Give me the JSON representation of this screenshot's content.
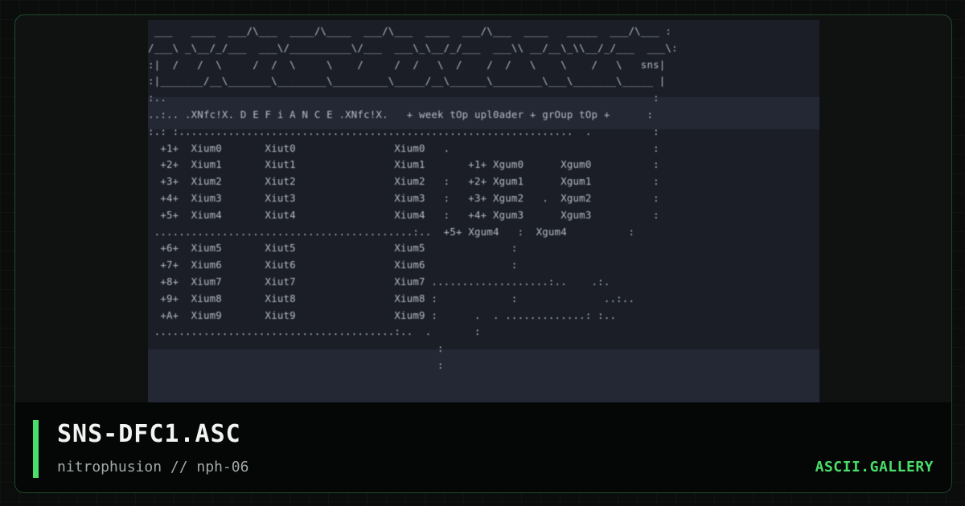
{
  "artwork": {
    "lines": [
      " ___   ____  ___/\\___  ____/\\____  ___/\\___  ____  ___/\\___  ____   _____  ___/\\___ :",
      "/___\\ _\\__/_/___  ___\\/__________\\/___  ___\\_\\__/_/___  ___\\\\ __/__\\_\\\\__/_/___  ___\\:",
      ":|  /   /  \\     /  /  \\     \\    /     /  /   \\  /    /  /   \\    \\    /   \\   sns|",
      ":|_______/__\\_______\\________\\_________\\_____/__\\______\\________\\___\\_______\\_____ |",
      ":..                                                                               :",
      "..:.. .XNfc!X. D E F i A N C E .XNfc!X.   + week tOp upl0ader + grOup tOp +      :",
      ":.: :................................................................  .          :",
      "  +1+  Xium0       Xiut0                Xium0   .                                 :",
      "  +2+  Xium1       Xiut1                Xium1       +1+ Xgum0      Xgum0          :",
      "  +3+  Xium2       Xiut2                Xium2   :   +2+ Xgum1      Xgum1          :",
      "  +4+  Xium3       Xiut3                Xium3   :   +3+ Xgum2   .  Xgum2          :",
      "  +5+  Xium4       Xiut4                Xium4   :   +4+ Xgum3      Xgum3          :",
      " ..........................................:..  +5+ Xgum4   :  Xgum4          :",
      "  +6+  Xium5       Xiut5                Xium5              :                      ",
      "  +7+  Xium6       Xiut6                Xium6              :                      ",
      "  +8+  Xium7       Xiut7                Xium7 ...................:..    .:.       ",
      "  +9+  Xium8       Xiut8                Xium8 :            :              ..:..   ",
      "  +A+  Xium9       Xiut9                Xium9 :      .  . .............: :..      ",
      " .......................................:..  .       :                            ",
      "                                               :                                  ",
      "                                               :                                  "
    ]
  },
  "footer": {
    "title": "SNS-DFC1.ASC",
    "subtitle": "nitrophusion // nph-06",
    "brand": "ASCII.GALLERY"
  },
  "colors": {
    "accent": "#4ade6a",
    "art_background": "#1b1e26",
    "art_text": "#b6bcc8"
  }
}
